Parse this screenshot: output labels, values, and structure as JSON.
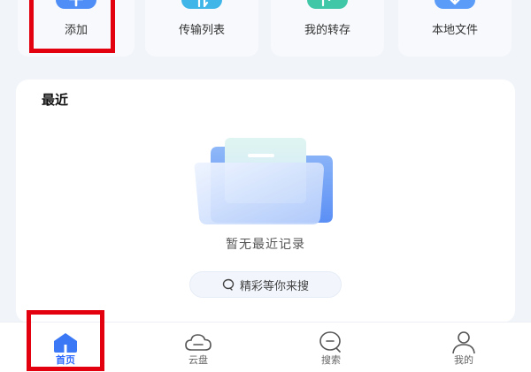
{
  "quick_actions": [
    {
      "label": "添加",
      "icon": "plus-icon",
      "color": "#4f8ef7"
    },
    {
      "label": "传输列表",
      "icon": "transfer-icon",
      "color": "#3fb5e8"
    },
    {
      "label": "我的转存",
      "icon": "share-forward-icon",
      "color": "#3fc7a8"
    },
    {
      "label": "本地文件",
      "icon": "download-icon",
      "color": "#5a9cf8"
    }
  ],
  "recent": {
    "title": "最近",
    "empty_text": "暂无最近记录",
    "search_placeholder": "精彩等你来搜"
  },
  "bottom_nav": [
    {
      "label": "首页",
      "icon": "home-icon",
      "active": true
    },
    {
      "label": "云盘",
      "icon": "cloud-icon",
      "active": false
    },
    {
      "label": "搜索",
      "icon": "search-icon",
      "active": false
    },
    {
      "label": "我的",
      "icon": "profile-icon",
      "active": false
    }
  ],
  "colors": {
    "accent": "#2f6bff",
    "highlight": "#e3000f",
    "background": "#f1f4f9"
  }
}
